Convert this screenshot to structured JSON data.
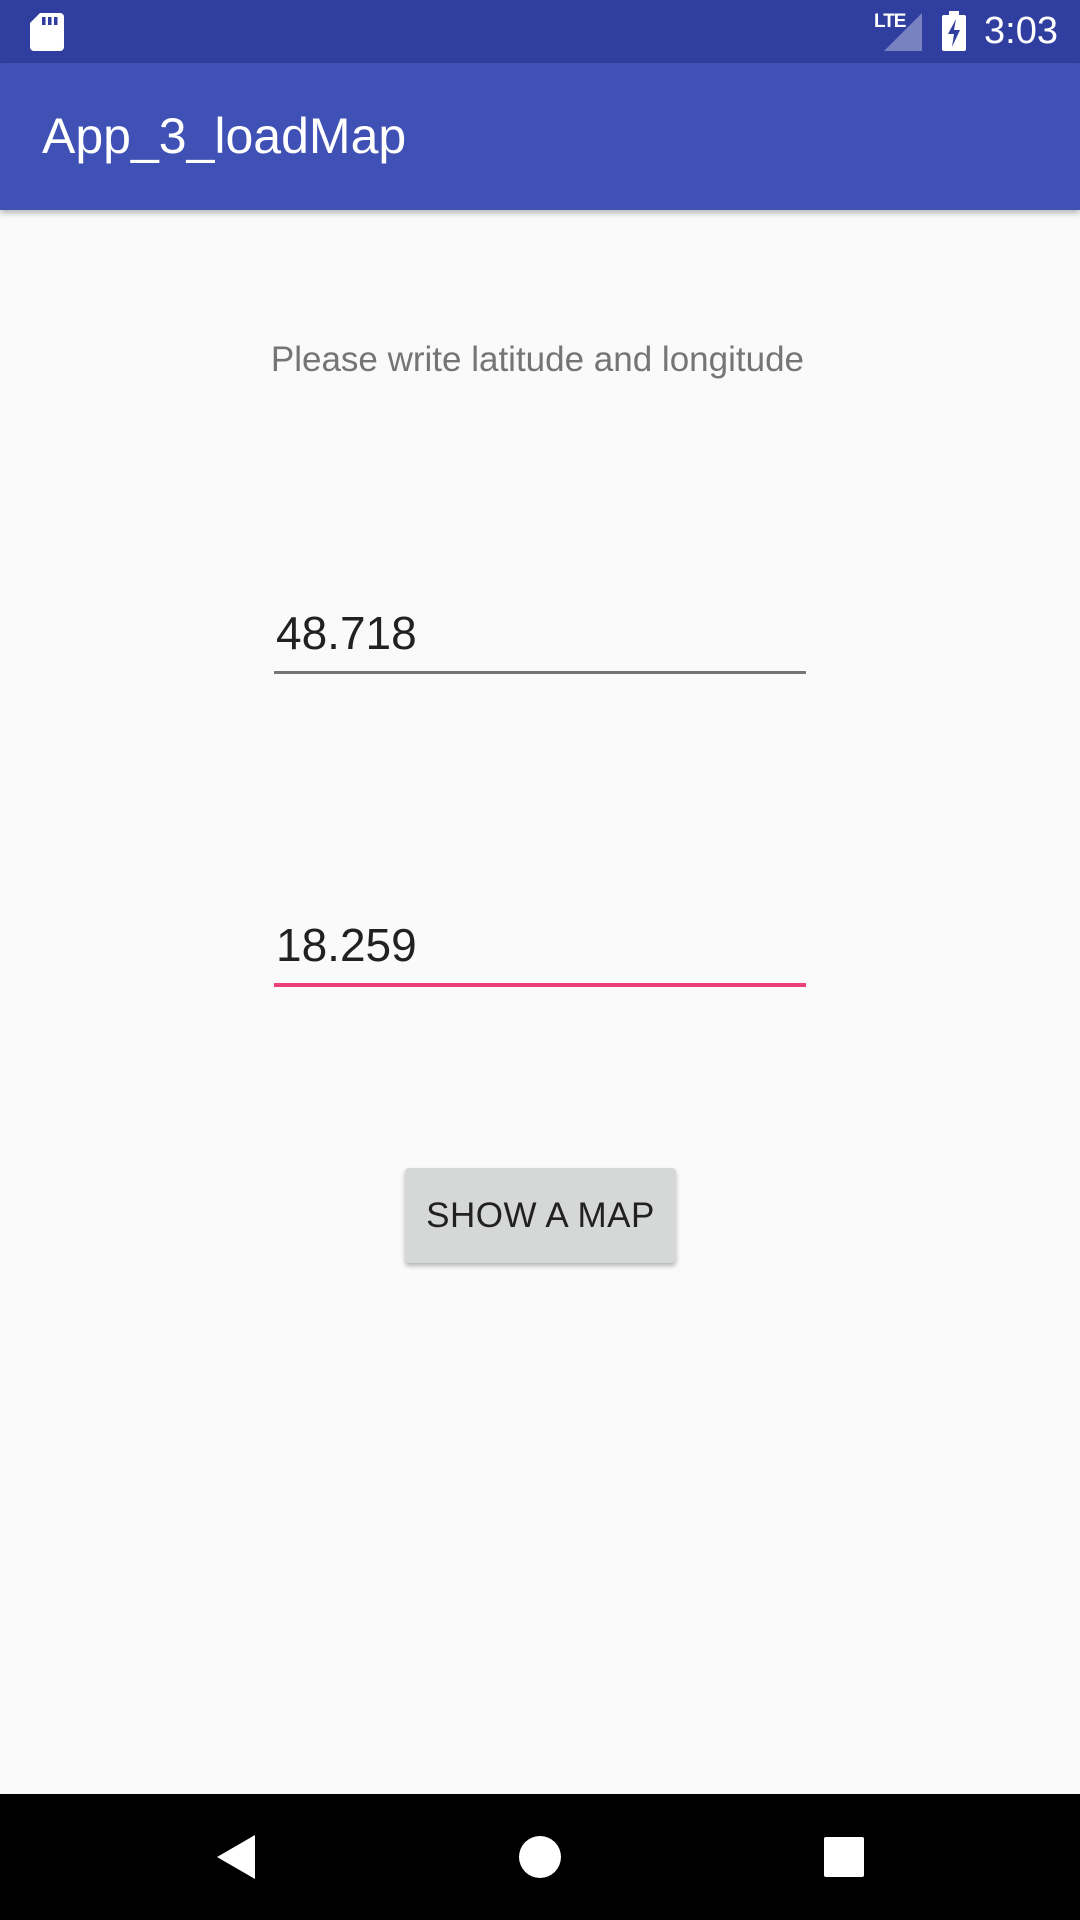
{
  "status_bar": {
    "network_label": "LTE",
    "time": "3:03",
    "icons": [
      "sd-card-icon",
      "signal-icon",
      "battery-charging-icon"
    ]
  },
  "app_bar": {
    "title": "App_3_loadMap",
    "color": "#3f51b5",
    "status_color": "#303f9f"
  },
  "form": {
    "instruction": "Please write latitude and longitude",
    "latitude_value": "48.718",
    "longitude_value": "18.259",
    "focused_field": "longitude",
    "accent_color": "#ec407a",
    "button_label": "SHOW A MAP"
  },
  "nav_bar": {
    "icons": [
      "back-icon",
      "home-icon",
      "recents-icon"
    ]
  }
}
